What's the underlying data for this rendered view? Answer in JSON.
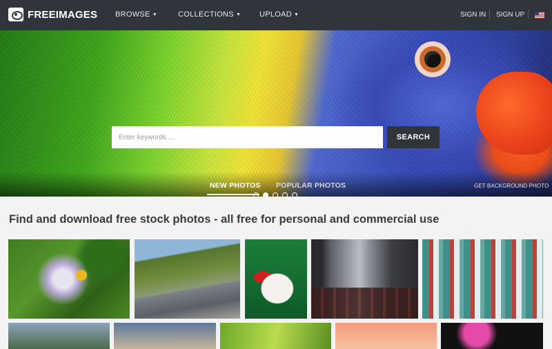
{
  "nav": {
    "logo_text": "FREEIMAGES",
    "menu": [
      {
        "label": "BROWSE"
      },
      {
        "label": "COLLECTIONS"
      },
      {
        "label": "UPLOAD"
      }
    ],
    "sign_in": "SIGN IN",
    "sign_up": "SIGN UP"
  },
  "hero": {
    "search_placeholder": "Enter keywords ...",
    "search_button": "SEARCH",
    "slides_total": 5,
    "active_slide": 2,
    "tabs": [
      {
        "label": "NEW PHOTOS",
        "active": true
      },
      {
        "label": "POPULAR PHOTOS",
        "active": false
      }
    ],
    "background_link": "GET BACKGROUND PHOTO"
  },
  "main": {
    "tagline": "Find and download free stock photos - all free for personal and commercial use"
  },
  "colors": {
    "nav_bg": "#2f353b",
    "page_bg": "#f3f3f3",
    "button_bg": "#2f353b"
  },
  "icons": {
    "logo": "eye-logo-icon",
    "dropdown": "caret-down-icon",
    "language": "us-flag-icon"
  }
}
